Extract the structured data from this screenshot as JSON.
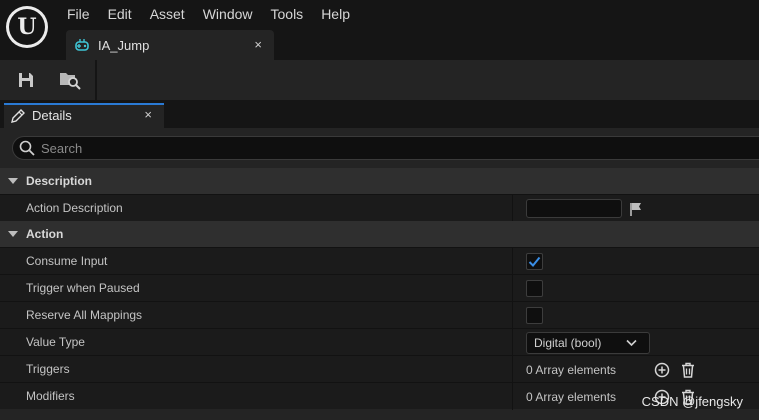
{
  "menu": [
    "File",
    "Edit",
    "Asset",
    "Window",
    "Tools",
    "Help"
  ],
  "document_tab": {
    "label": "IA_Jump",
    "close": "×"
  },
  "details_tab": {
    "label": "Details",
    "close": "×"
  },
  "search": {
    "placeholder": "Search",
    "value": ""
  },
  "categories": {
    "description": {
      "label": "Description"
    },
    "action": {
      "label": "Action"
    }
  },
  "properties": {
    "action_description": {
      "label": "Action Description",
      "value": ""
    },
    "consume_input": {
      "label": "Consume Input",
      "checked": true
    },
    "trigger_when_paused": {
      "label": "Trigger when Paused",
      "checked": false
    },
    "reserve_all_mappings": {
      "label": "Reserve All Mappings",
      "checked": false
    },
    "value_type": {
      "label": "Value Type",
      "value": "Digital (bool)"
    },
    "triggers": {
      "label": "Triggers",
      "value": "0 Array elements"
    },
    "modifiers": {
      "label": "Modifiers",
      "value": "0 Array elements"
    }
  },
  "watermark": "CSDN @jfengsky",
  "colors": {
    "accent": "#2a7ad5",
    "checkmark": "#3a8ee6",
    "panel": "#242424",
    "row": "#1b1b1b"
  }
}
